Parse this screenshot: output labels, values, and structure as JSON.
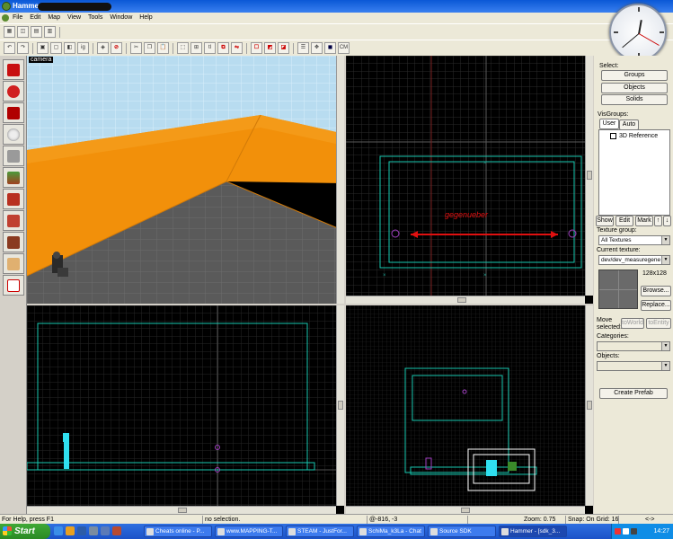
{
  "window": {
    "title": "Hamme"
  },
  "menu": [
    "File",
    "Edit",
    "Map",
    "View",
    "Tools",
    "Window",
    "Help"
  ],
  "toolbar": {
    "cm_label": "CM",
    "ig_label": "ig",
    "tl_label": "tl"
  },
  "viewports": {
    "camera_label": "camera",
    "annotation_text": "gegenueber"
  },
  "right_panel": {
    "select_label": "Select:",
    "groups_button": "Groups",
    "objects_button": "Objects",
    "solids_button": "Solids",
    "visgroups_label": "VisGroups:",
    "tab_user": "User",
    "tab_auto": "Auto",
    "visgroup_item": "3D Reference",
    "show_button": "Show",
    "edit_button": "Edit",
    "mark_button": "Mark",
    "texture_group_label": "Texture group:",
    "texture_group_value": "All Textures",
    "current_texture_label": "Current texture:",
    "current_texture_value": "dev/dev_measuregene",
    "texture_size": "128x128",
    "browse_button": "Browse...",
    "replace_button": "Replace...",
    "move_selected_label": "Move selected:",
    "to_world_button": "toWorld",
    "to_entity_button": "toEntity",
    "categories_label": "Categories:",
    "objects_label": "Objects:",
    "create_prefab_button": "Create Prefab"
  },
  "status": {
    "help": "For Help, press F1",
    "selection": "no selection.",
    "coords": "@-816, -3",
    "zoom": "Zoom: 0.75",
    "snap": "Snap: On Grid: 16",
    "extra": "<->"
  },
  "taskbar": {
    "start": "Start",
    "tasks": [
      "Cheats online - P...",
      "www.MAPPING-T...",
      "STEAM - JustFor...",
      "SchiMa_k3La - Chat",
      "Source SDK",
      "Hammer - [sdk_3..."
    ],
    "clock": "14:27"
  },
  "colors": {
    "sky": "#b8dcf0",
    "orange_wall": "#f2900a",
    "floor": "#5a5a5a",
    "grid_major": "#3a3a3a",
    "brush_outline": "#18c8b0",
    "annotation": "#e01010"
  }
}
